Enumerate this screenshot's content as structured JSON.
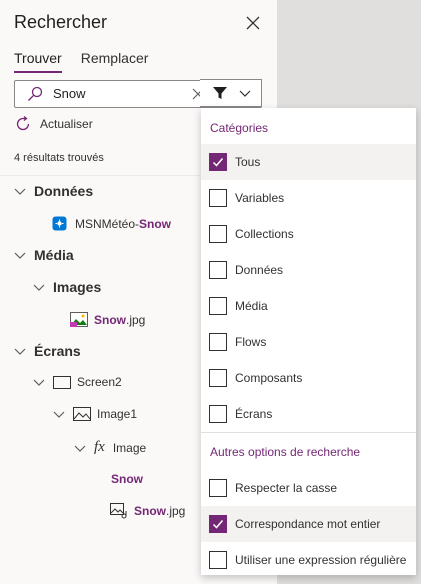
{
  "panel": {
    "title": "Rechercher",
    "tabs": [
      {
        "label": "Trouver",
        "active": true
      },
      {
        "label": "Remplacer",
        "active": false
      }
    ],
    "search": {
      "value": "Snow",
      "placeholder": ""
    },
    "refresh_label": "Actualiser",
    "results_count": "4 résultats trouvés"
  },
  "tree": {
    "donnees": {
      "label": "Données"
    },
    "msn": {
      "prefix": "MSNMétéo-",
      "match": "Snow"
    },
    "media": {
      "label": "Média"
    },
    "images": {
      "label": "Images"
    },
    "snowjpg1": {
      "match": "Snow",
      "suffix": ".jpg"
    },
    "ecrans": {
      "label": "Écrans"
    },
    "screen2": {
      "label": "Screen2"
    },
    "image1": {
      "label": "Image1"
    },
    "image_prop": {
      "label": "Image",
      "fx": "fx"
    },
    "snow_value": {
      "match": "Snow"
    },
    "snowjpg2": {
      "match": "Snow",
      "suffix": ".jpg"
    }
  },
  "filter": {
    "categories_header": "Catégories",
    "categories": [
      {
        "label": "Tous",
        "checked": true
      },
      {
        "label": "Variables",
        "checked": false
      },
      {
        "label": "Collections",
        "checked": false
      },
      {
        "label": "Données",
        "checked": false
      },
      {
        "label": "Média",
        "checked": false
      },
      {
        "label": "Flows",
        "checked": false
      },
      {
        "label": "Composants",
        "checked": false
      },
      {
        "label": "Écrans",
        "checked": false
      }
    ],
    "options_header": "Autres options de recherche",
    "options": [
      {
        "label": "Respecter la casse",
        "checked": false
      },
      {
        "label": "Correspondance mot entier",
        "checked": true
      },
      {
        "label": "Utiliser une expression régulière",
        "checked": false
      }
    ]
  },
  "colors": {
    "accent": "#742774",
    "panel_bg": "#faf9f8",
    "backdrop": "#e1dfdd",
    "datasource_icon": "#0078d4"
  },
  "icons": [
    "close-icon",
    "search-icon",
    "clear-icon",
    "filter-icon",
    "chevron-down-icon",
    "refresh-icon",
    "chevron-icon",
    "datasource-icon",
    "image-icon",
    "screen-icon",
    "media-file-icon",
    "checkmark-icon"
  ]
}
